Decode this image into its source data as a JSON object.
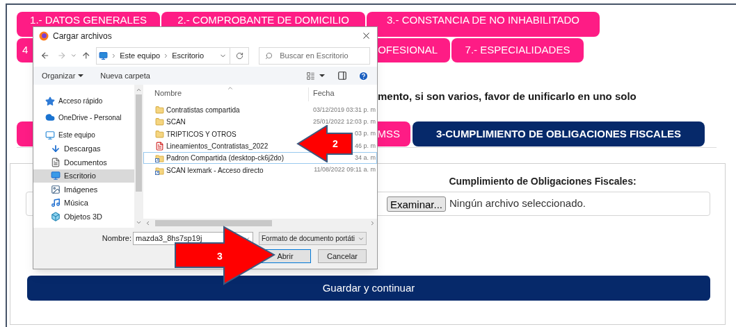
{
  "main_tab_rows": [
    {
      "tabs": [
        {
          "label": "1.- DATOS GENERALES"
        },
        {
          "label": "2.- COMPROBANTE DE DOMICILIO"
        },
        {
          "label": "3.- CONSTANCIA DE NO INHABILITADO"
        }
      ]
    },
    {
      "tabs": [
        {
          "label": "4"
        },
        {
          "label": "OFESIONAL"
        },
        {
          "label": "7.- ESPECIALIDADES"
        }
      ]
    }
  ],
  "instruction": "mento, si son varios, favor de unificarlo en uno solo",
  "sub_tabs": [
    {
      "label": "MSS",
      "selected": false
    },
    {
      "label": "3-CUMPLIMIENTO DE OBLIGACIONES FISCALES",
      "selected": true
    }
  ],
  "upload": {
    "label": "Cumplimiento de Obligaciones Fiscales:",
    "browse_button": "Examinar...",
    "status": "Ningún archivo seleccionado."
  },
  "save_button": "Guardar y continuar",
  "dialog": {
    "title": "Cargar archivos",
    "path": [
      "Este equipo",
      "Escritorio"
    ],
    "search_placeholder": "Buscar en Escritorio",
    "toolbar": [
      "Organizar",
      "Nueva carpeta"
    ],
    "nav": [
      {
        "label": "Acceso rápido",
        "kind": "star",
        "selected": false
      },
      {
        "label": "OneDrive - Personal",
        "kind": "cloud",
        "selected": false
      },
      {
        "label": "Este equipo",
        "kind": "pc",
        "selected": false
      },
      {
        "label": "Descargas",
        "kind": "download",
        "selected": false
      },
      {
        "label": "Documentos",
        "kind": "document",
        "selected": false
      },
      {
        "label": "Escritorio",
        "kind": "desktop",
        "selected": true
      },
      {
        "label": "Imágenes",
        "kind": "image",
        "selected": false
      },
      {
        "label": "Música",
        "kind": "music",
        "selected": false
      },
      {
        "label": "Objetos 3D",
        "kind": "cube",
        "selected": false
      }
    ],
    "columns": [
      "Nombre",
      "Fecha"
    ],
    "files": [
      {
        "name": "Contratistas compartida",
        "date": "03/12/2019 03:31 p. m",
        "kind": "folder",
        "selected": false
      },
      {
        "name": "SCAN",
        "date": "25/01/2022 12:03 p. m",
        "kind": "folder",
        "selected": false
      },
      {
        "name": "TRIPTICOS Y OTROS",
        "date": "03 p. m",
        "kind": "folder",
        "selected": false
      },
      {
        "name": "Lineamientos_Contratistas_2022",
        "date": "46 p. m",
        "kind": "pdf",
        "selected": false
      },
      {
        "name": "Padron Compartida (desktop-ck6j2do)",
        "date": "34 a. m",
        "kind": "shortcut",
        "selected": true
      },
      {
        "name": "SCAN lexmark - Acceso directo",
        "date": "11/08/2022 09:11 a. m",
        "kind": "shortcut",
        "selected": false
      }
    ],
    "filename_label": "Nombre:",
    "filename": "mazda3_8hs7sp19j",
    "filter": "Formato de documento portáti",
    "open_button": "Abrir",
    "cancel_button": "Cancelar"
  },
  "annotations": [
    {
      "number": "2",
      "kind": "left"
    },
    {
      "number": "3",
      "kind": "right"
    }
  ]
}
